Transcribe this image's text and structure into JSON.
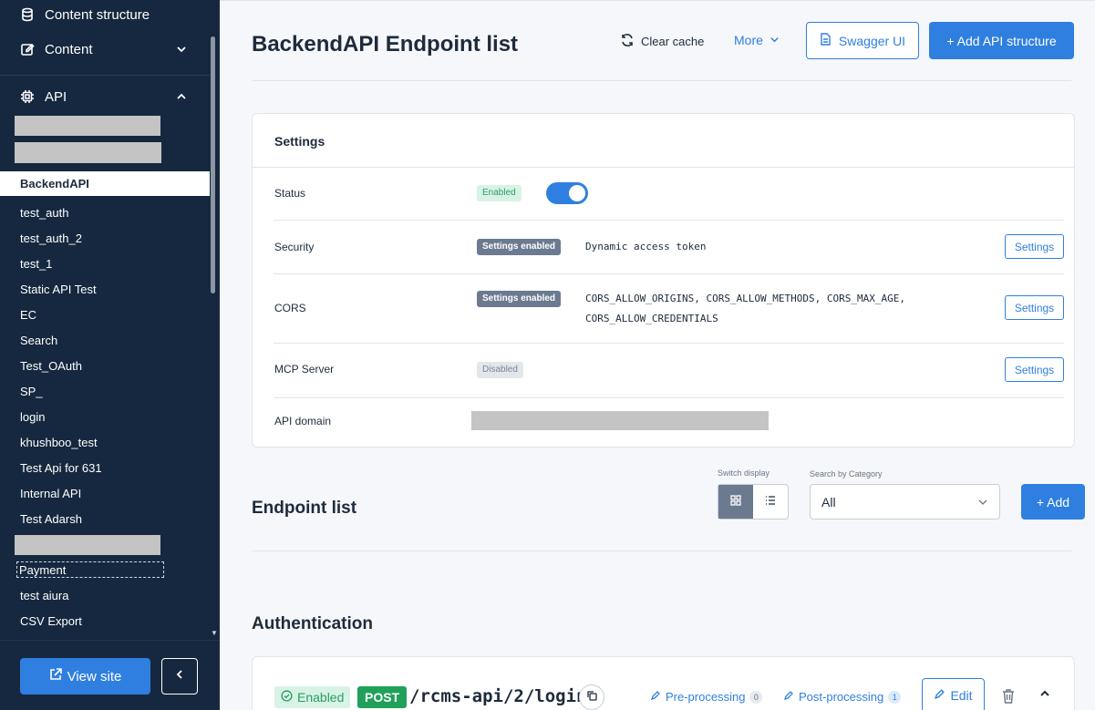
{
  "sidebar": {
    "content_structure": "Content structure",
    "content": "Content",
    "api": "API",
    "items": [
      {
        "label": "BackendAPI"
      },
      {
        "label": "test_auth"
      },
      {
        "label": "test_auth_2"
      },
      {
        "label": "test_1"
      },
      {
        "label": "Static API Test"
      },
      {
        "label": "EC"
      },
      {
        "label": "Search"
      },
      {
        "label": "Test_OAuth"
      },
      {
        "label": "SP_"
      },
      {
        "label": "login"
      },
      {
        "label": "khushboo_test"
      },
      {
        "label": "Test Api for 631"
      },
      {
        "label": "Internal API"
      },
      {
        "label": "Test Adarsh"
      },
      {
        "label": "Payment"
      },
      {
        "label": "test aiura"
      },
      {
        "label": "CSV Export"
      }
    ],
    "view_site": "View site"
  },
  "header": {
    "title": "BackendAPI Endpoint list",
    "clear_cache": "Clear cache",
    "more": "More",
    "swagger": "Swagger UI",
    "add_api": "+ Add API structure"
  },
  "settings": {
    "title": "Settings",
    "status": {
      "label": "Status",
      "badge": "Enabled",
      "on": true
    },
    "security": {
      "label": "Security",
      "badge": "Settings enabled",
      "value": "Dynamic access token",
      "button": "Settings"
    },
    "cors": {
      "label": "CORS",
      "badge": "Settings enabled",
      "value_line1": "CORS_ALLOW_ORIGINS, CORS_ALLOW_METHODS, CORS_MAX_AGE,",
      "value_line2": "CORS_ALLOW_CREDENTIALS",
      "button": "Settings"
    },
    "mcp": {
      "label": "MCP Server",
      "badge": "Disabled",
      "button": "Settings"
    },
    "domain": {
      "label": "API domain"
    }
  },
  "endpoints": {
    "title": "Endpoint list",
    "switch_label": "Switch display",
    "category_label": "Search by Category",
    "category_value": "All",
    "add": "+ Add"
  },
  "authentication": {
    "title": "Authentication",
    "endpoint": {
      "status": "Enabled",
      "method": "POST",
      "path": "/rcms-api/2/login",
      "pre_processing": "Pre-processing",
      "pre_count": "0",
      "post_processing": "Post-processing",
      "post_count": "1",
      "edit": "Edit"
    }
  },
  "colors": {
    "sidebar": "#16283f",
    "accent": "#2f7fe0",
    "success": "#21a05a"
  }
}
